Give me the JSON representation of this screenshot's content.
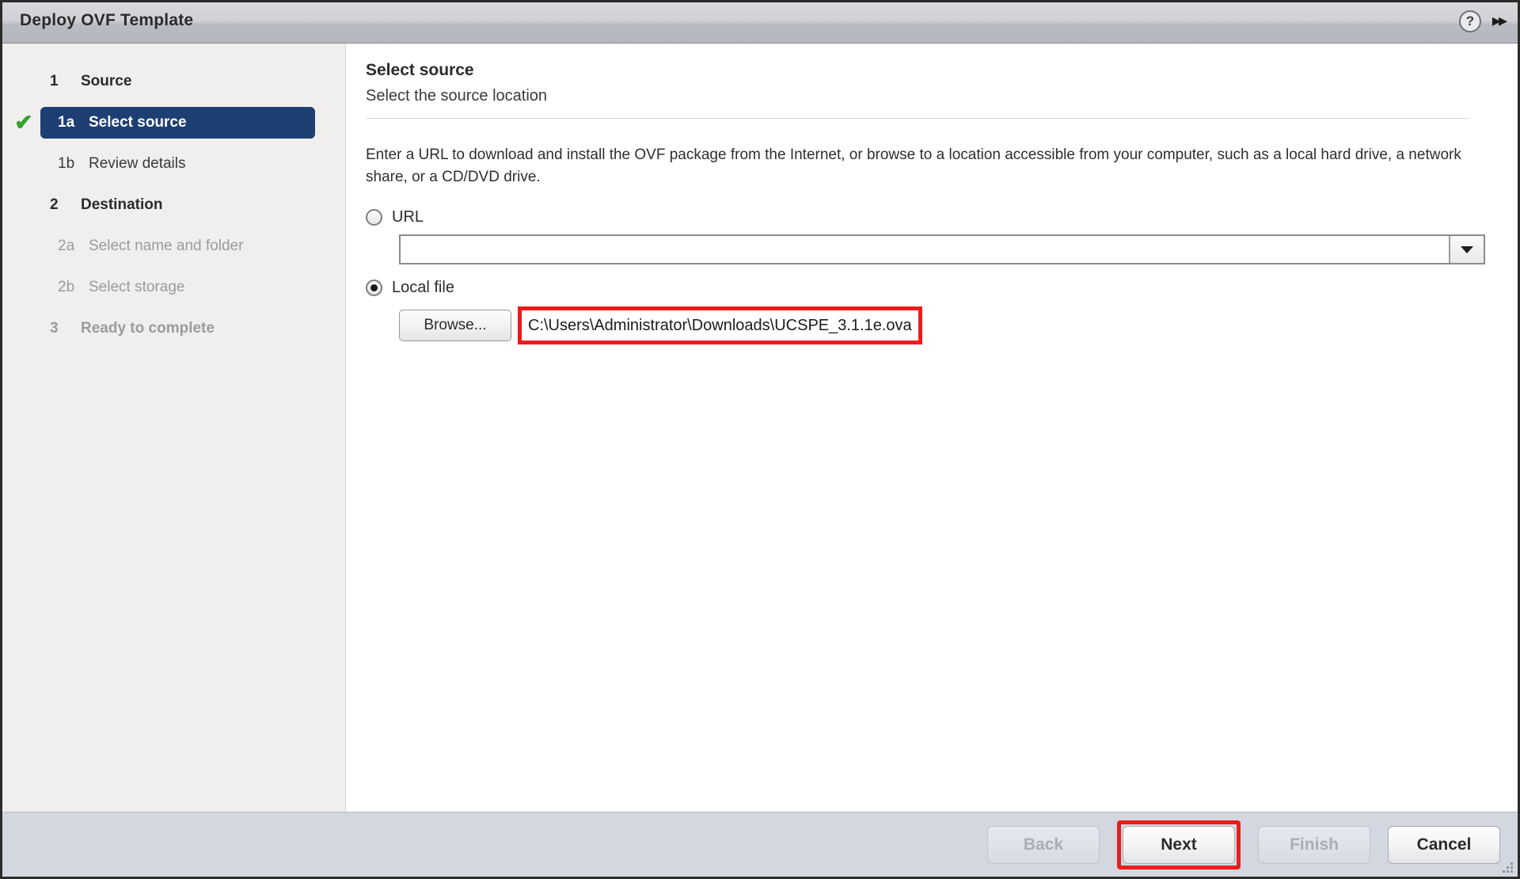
{
  "window": {
    "title": "Deploy OVF Template",
    "help_icon": "help-icon",
    "expand_icon": "double-chevron-right-icon"
  },
  "sidebar": {
    "items": [
      {
        "num": "1",
        "label": "Source",
        "level": 1,
        "state": "active",
        "check": false
      },
      {
        "num": "1a",
        "label": "Select source",
        "level": 2,
        "state": "selected",
        "check": true
      },
      {
        "num": "1b",
        "label": "Review details",
        "level": 2,
        "state": "active",
        "check": false
      },
      {
        "num": "2",
        "label": "Destination",
        "level": 1,
        "state": "active",
        "check": false
      },
      {
        "num": "2a",
        "label": "Select name and folder",
        "level": 2,
        "state": "disabled",
        "check": false
      },
      {
        "num": "2b",
        "label": "Select storage",
        "level": 2,
        "state": "disabled",
        "check": false
      },
      {
        "num": "3",
        "label": "Ready to complete",
        "level": 1,
        "state": "disabled",
        "check": false
      }
    ]
  },
  "main": {
    "title": "Select source",
    "subtitle": "Select the source location",
    "instructions": "Enter a URL to download and install the OVF package from the Internet, or browse to a location accessible from your computer, such as a local hard drive, a network share, or a CD/DVD drive.",
    "url_option": {
      "label": "URL",
      "selected": false,
      "value": "",
      "placeholder": "",
      "dropdown_icon": "chevron-down-icon"
    },
    "local_option": {
      "label": "Local file",
      "selected": true,
      "browse_label": "Browse...",
      "path": "C:\\Users\\Administrator\\Downloads\\UCSPE_3.1.1e.ova",
      "highlighted": true
    }
  },
  "footer": {
    "buttons": [
      {
        "label": "Back",
        "enabled": false,
        "highlighted": false
      },
      {
        "label": "Next",
        "enabled": true,
        "highlighted": true
      },
      {
        "label": "Finish",
        "enabled": false,
        "highlighted": false
      },
      {
        "label": "Cancel",
        "enabled": true,
        "highlighted": false
      }
    ]
  },
  "colors": {
    "selected_nav": "#1e3f73",
    "check_green": "#35a32b",
    "highlight_red": "#ee1b1b",
    "footer_bg": "#d3d8e0",
    "sidebar_bg": "#f1efed"
  }
}
